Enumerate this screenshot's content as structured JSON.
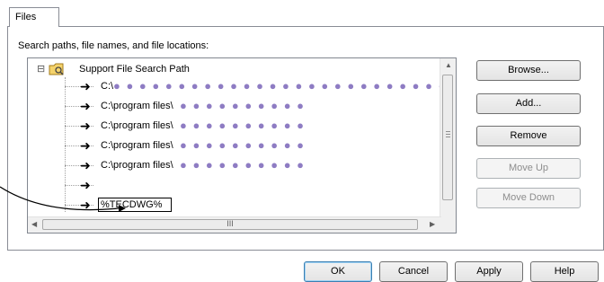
{
  "tab": {
    "label": "Files"
  },
  "section_label": "Search paths, file names, and file locations:",
  "tree": {
    "root": {
      "expander": "⊟",
      "label": "Support File Search Path"
    },
    "children": [
      {
        "path": "C:\\",
        "masked": "● ● ● ● ● ● ● ● ● ● ● ● ● ● ● ● ● ● ● ● ● ● ● ● ● ●"
      },
      {
        "path": "C:\\program files\\",
        "masked": "● ● ● ● ● ● ● ● ● ●"
      },
      {
        "path": "C:\\program files\\",
        "masked": "● ● ● ● ● ● ● ● ● ●"
      },
      {
        "path": "C:\\program files\\",
        "masked": "● ● ● ● ● ● ● ● ● ●"
      },
      {
        "path": "C:\\program files\\",
        "masked": "● ● ● ● ● ● ● ● ● ●"
      },
      {
        "path": "",
        "masked": ""
      }
    ],
    "edit_value": "%TECDWG%",
    "hscroll_grip": "III"
  },
  "side_buttons": {
    "browse": "Browse...",
    "add": "Add...",
    "remove": "Remove",
    "move_up": "Move Up",
    "move_down": "Move Down"
  },
  "dialog_buttons": {
    "ok": "OK",
    "cancel": "Cancel",
    "apply": "Apply",
    "help": "Help"
  }
}
